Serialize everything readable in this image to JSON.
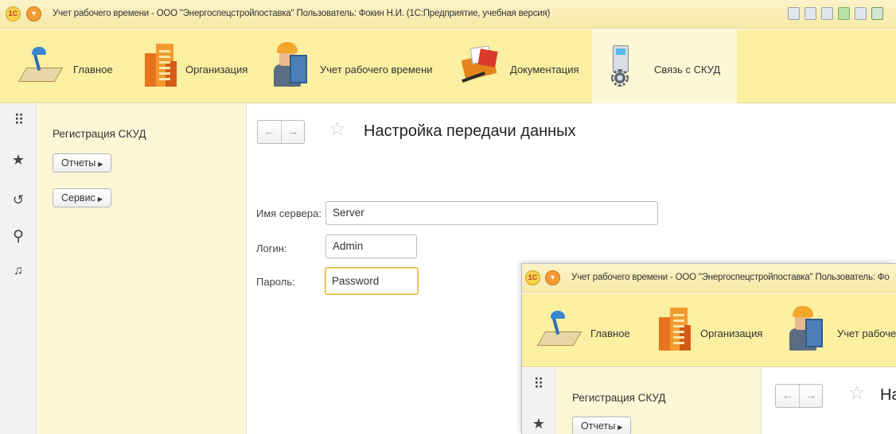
{
  "window": {
    "title": "Учет рабочего времени - ООО \"Энергоспецстройпоставка\" Пользователь: Фокин Н.И.  (1С:Предприятие, учебная версия)",
    "logo_text": "1С"
  },
  "sections": [
    {
      "label": "Главное",
      "icon": "desk-lamp-icon"
    },
    {
      "label": "Организация",
      "icon": "buildings-icon"
    },
    {
      "label": "Учет рабочего времени",
      "icon": "worker-icon"
    },
    {
      "label": "Документация",
      "icon": "documents-box-icon"
    },
    {
      "label": "Связь с СКУД",
      "icon": "skud-device-icon"
    }
  ],
  "left_toolbar": [
    "apps-grid-icon",
    "favorites-star-icon",
    "history-icon",
    "search-icon",
    "notifications-bell-icon"
  ],
  "nav_panel": {
    "title": "Регистрация СКУД",
    "buttons": [
      "Отчеты",
      "Сервис"
    ]
  },
  "form": {
    "title": "Настройка передачи данных",
    "fields": {
      "server_label": "Имя сервера:",
      "server_value": "Server",
      "login_label": "Логин:",
      "login_value": "Admin",
      "password_label": "Пароль:",
      "password_value": "Password"
    }
  },
  "overlay": {
    "title": "Учет рабочего времени - ООО \"Энергоспецстройпоставка\" Пользователь: Фо",
    "sections": [
      "Главное",
      "Организация",
      "Учет рабоче"
    ],
    "nav_title": "Регистрация СКУД",
    "nav_button": "Отчеты",
    "form_title": "На"
  },
  "colors": {
    "title_bar": "#f6e9a8",
    "sections_bar": "#fbefa2",
    "nav_panel": "#fdf6d5",
    "focus_border": "#e7b33d"
  }
}
